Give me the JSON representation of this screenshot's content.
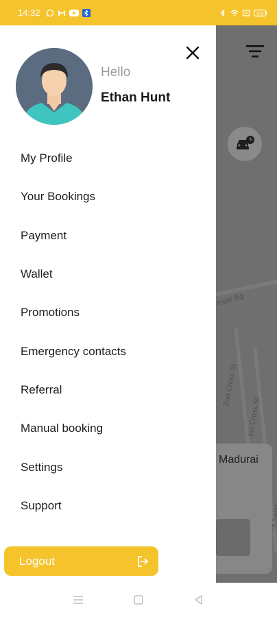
{
  "status_bar": {
    "time": "14:32",
    "left_icons": [
      "whatsapp-icon",
      "gmail-icon",
      "youtube-icon",
      "bluetooth-app-icon"
    ],
    "right_icons": [
      "bluetooth-icon",
      "wifi-icon",
      "sim-icon",
      "battery-icon"
    ],
    "battery_label": "100"
  },
  "drawer": {
    "greeting": "Hello",
    "user_name": "Ethan Hunt",
    "menu_items": [
      {
        "label": "My Profile"
      },
      {
        "label": "Your Bookings"
      },
      {
        "label": "Payment"
      },
      {
        "label": "Wallet"
      },
      {
        "label": "Promotions"
      },
      {
        "label": "Emergency contacts"
      },
      {
        "label": "Referral"
      },
      {
        "label": "Manual booking"
      },
      {
        "label": "Settings"
      },
      {
        "label": "Support"
      }
    ],
    "logout_label": "Logout"
  },
  "map": {
    "road_labels": [
      "Vaigai Rd",
      "2nd Cross St",
      "1st Cross St",
      "Anna Salai"
    ],
    "card_text": "Madurai"
  },
  "colors": {
    "accent": "#f5c32c",
    "overlay": "#6f6f6f",
    "text": "#1d1d1d",
    "muted": "#9a9a9a"
  },
  "nav_bar": {
    "buttons": [
      "menu-icon",
      "home-icon",
      "back-icon"
    ]
  }
}
